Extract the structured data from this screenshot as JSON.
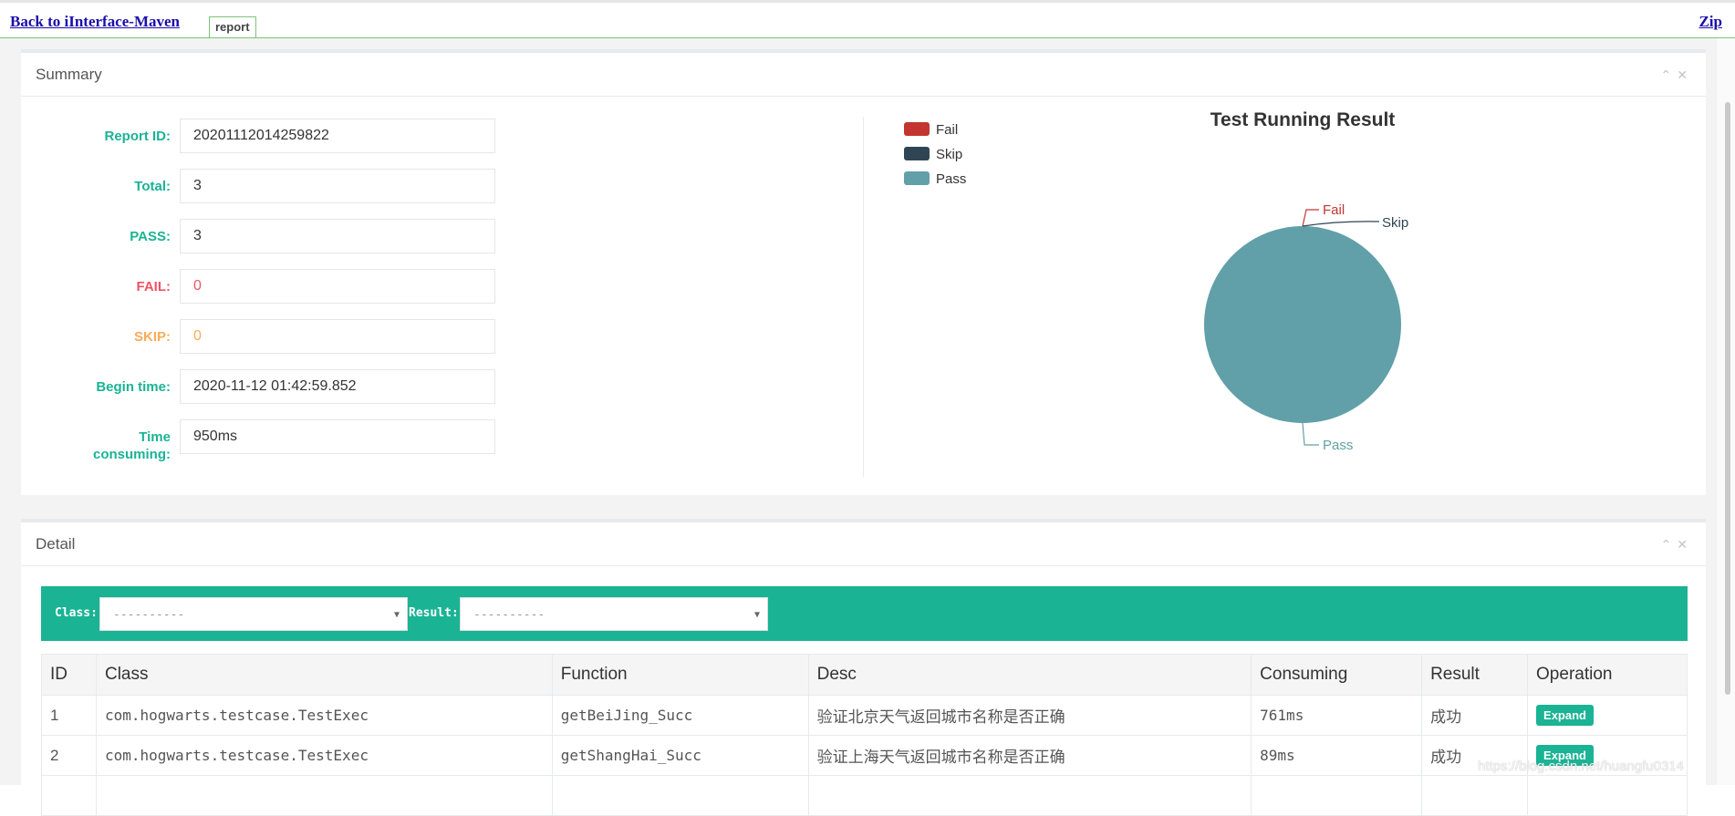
{
  "topbar": {
    "back_label": "Back to iInterface-Maven",
    "tab_label": "report",
    "zip_label": "Zip"
  },
  "summary": {
    "title": "Summary",
    "fields": [
      {
        "label": "Report ID:",
        "value": "20201112014259822"
      },
      {
        "label": "Total:",
        "value": "3"
      },
      {
        "label": "PASS:",
        "value": "3"
      },
      {
        "label": "FAIL:",
        "value": "0"
      },
      {
        "label": "SKIP:",
        "value": "0"
      },
      {
        "label": "Begin time:",
        "value": "2020-11-12 01:42:59.852"
      },
      {
        "label": "Time consuming:",
        "value": "950ms"
      }
    ]
  },
  "chart_data": {
    "type": "pie",
    "title": "Test Running Result",
    "legend_position": "top-left",
    "series": [
      {
        "name": "Fail",
        "value": 0,
        "color": "#c23531"
      },
      {
        "name": "Skip",
        "value": 0,
        "color": "#2f4554"
      },
      {
        "name": "Pass",
        "value": 3,
        "color": "#61a0a8"
      }
    ]
  },
  "detail": {
    "title": "Detail",
    "filters": {
      "class_label": "Class:",
      "class_value": "----------",
      "result_label": "Result:",
      "result_value": "----------"
    },
    "columns": [
      "ID",
      "Class",
      "Function",
      "Desc",
      "Consuming",
      "Result",
      "Operation"
    ],
    "rows": [
      {
        "id": "1",
        "class": "com.hogwarts.testcase.TestExec",
        "function": "getBeiJing_Succ",
        "desc": "验证北京天气返回城市名称是否正确",
        "consuming": "761ms",
        "result": "成功",
        "op": "Expand"
      },
      {
        "id": "2",
        "class": "com.hogwarts.testcase.TestExec",
        "function": "getShangHai_Succ",
        "desc": "验证上海天气返回城市名称是否正确",
        "consuming": "89ms",
        "result": "成功",
        "op": "Expand"
      }
    ]
  },
  "watermark": "https://blog.csdn.net/huangfu0314",
  "colors": {
    "accent": "#1ab394",
    "fail": "#ed5565",
    "skip": "#f8ac59"
  },
  "icons": {
    "collapse": "chevron-up-icon",
    "close": "close-icon"
  }
}
